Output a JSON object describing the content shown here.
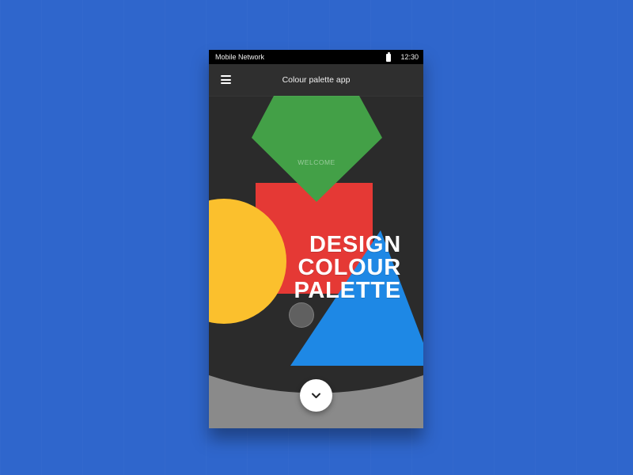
{
  "status_bar": {
    "network": "Mobile Network",
    "time": "12:30"
  },
  "app_bar": {
    "title": "Colour palette app"
  },
  "hero": {
    "welcome": "WELCOME",
    "lines": [
      "DESIGN",
      "COLOUR",
      "PALETTE"
    ]
  },
  "icons": {
    "menu": "menu-icon",
    "battery": "battery-icon",
    "chevron_down": "chevron-down-icon"
  },
  "colors": {
    "background": "#2f66cc",
    "green": "#43a047",
    "red": "#e53935",
    "yellow": "#fbc02d",
    "blue": "#1e88e5"
  }
}
